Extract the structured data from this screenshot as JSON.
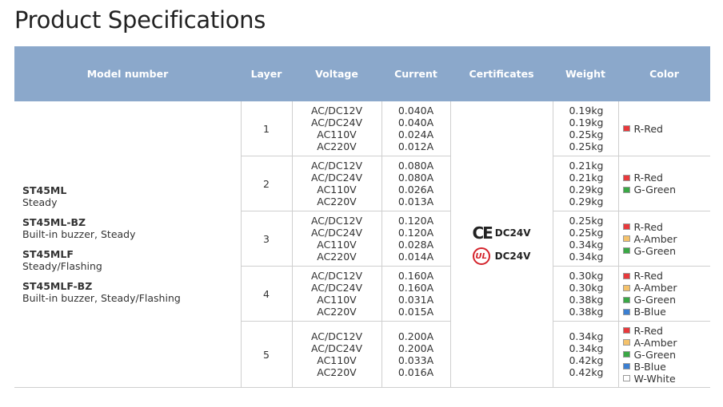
{
  "title": "Product Specifications",
  "headers": [
    "Model number",
    "Layer",
    "Voltage",
    "Current",
    "Certificates",
    "Weight",
    "Color"
  ],
  "models": [
    {
      "name": "ST45ML",
      "desc": "Steady"
    },
    {
      "name": "ST45ML-BZ",
      "desc": "Built-in buzzer, Steady"
    },
    {
      "name": "ST45MLF",
      "desc": "Steady/Flashing"
    },
    {
      "name": "ST45MLF-BZ",
      "desc": "Built-in buzzer, Steady/Flashing"
    }
  ],
  "certificates": [
    {
      "icon": "ce-mark-icon",
      "mark": "CE",
      "label": "DC24V"
    },
    {
      "icon": "ul-mark-icon",
      "mark": "UL",
      "label": "DC24V"
    }
  ],
  "color_swatches": {
    "R-Red": "#e8393c",
    "A-Amber": "#f5c26b",
    "G-Green": "#3aa845",
    "B-Blue": "#3b7fd1",
    "W-White": "#ffffff"
  },
  "rows": [
    {
      "layer": "1",
      "voltage": [
        "AC/DC12V",
        "AC/DC24V",
        "AC110V",
        "AC220V"
      ],
      "current": [
        "0.040A",
        "0.040A",
        "0.024A",
        "0.012A"
      ],
      "weight": [
        "0.19kg",
        "0.19kg",
        "0.25kg",
        "0.25kg"
      ],
      "colors": [
        "R-Red"
      ]
    },
    {
      "layer": "2",
      "voltage": [
        "AC/DC12V",
        "AC/DC24V",
        "AC110V",
        "AC220V"
      ],
      "current": [
        "0.080A",
        "0.080A",
        "0.026A",
        "0.013A"
      ],
      "weight": [
        "0.21kg",
        "0.21kg",
        "0.29kg",
        "0.29kg"
      ],
      "colors": [
        "R-Red",
        "G-Green"
      ]
    },
    {
      "layer": "3",
      "voltage": [
        "AC/DC12V",
        "AC/DC24V",
        "AC110V",
        "AC220V"
      ],
      "current": [
        "0.120A",
        "0.120A",
        "0.028A",
        "0.014A"
      ],
      "weight": [
        "0.25kg",
        "0.25kg",
        "0.34kg",
        "0.34kg"
      ],
      "colors": [
        "R-Red",
        "A-Amber",
        "G-Green"
      ]
    },
    {
      "layer": "4",
      "voltage": [
        "AC/DC12V",
        "AC/DC24V",
        "AC110V",
        "AC220V"
      ],
      "current": [
        "0.160A",
        "0.160A",
        "0.031A",
        "0.015A"
      ],
      "weight": [
        "0.30kg",
        "0.30kg",
        "0.38kg",
        "0.38kg"
      ],
      "colors": [
        "R-Red",
        "A-Amber",
        "G-Green",
        "B-Blue"
      ]
    },
    {
      "layer": "5",
      "voltage": [
        "AC/DC12V",
        "AC/DC24V",
        "AC110V",
        "AC220V"
      ],
      "current": [
        "0.200A",
        "0.200A",
        "0.033A",
        "0.016A"
      ],
      "weight": [
        "0.34kg",
        "0.34kg",
        "0.42kg",
        "0.42kg"
      ],
      "colors": [
        "R-Red",
        "A-Amber",
        "G-Green",
        "B-Blue",
        "W-White"
      ]
    }
  ]
}
